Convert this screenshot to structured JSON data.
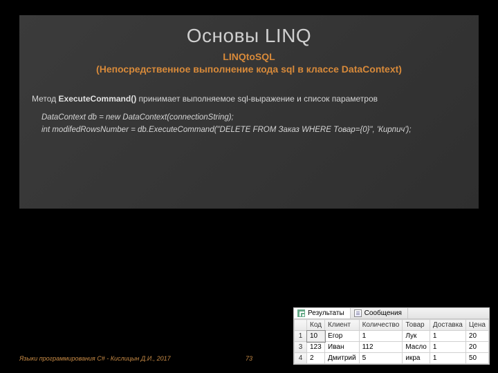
{
  "slide": {
    "title": "Основы LINQ",
    "subtitle": "LINQtoSQL",
    "subtitle2": "(Непосредственное выполнение кода sql в классе DataContext)",
    "body_pre": "Метод ",
    "body_strong": "ExecuteCommand()",
    "body_post": " принимает выполняемое sql-выражение и список параметров",
    "code": "DataContext db = new DataContext(connectionString);\nint modifedRowsNumber = db.ExecuteCommand(\"DELETE FROM Заказ WHERE Товар={0}\", 'Кирпич');",
    "footer": "Языки программирования C# - Кислицын Д.И., 2017",
    "page": "73"
  },
  "results_panel": {
    "tabs": [
      {
        "label": "Результаты",
        "icon": "grid-icon",
        "active": true
      },
      {
        "label": "Сообщения",
        "icon": "message-icon",
        "active": false
      }
    ],
    "columns": [
      "Код",
      "Клиент",
      "Количество",
      "Товар",
      "Доставка",
      "Цена"
    ],
    "rows": [
      {
        "n": "1",
        "cells": [
          "10",
          "Егор",
          "1",
          "Лук",
          "1",
          "20"
        ],
        "selected_col": 0
      },
      {
        "n": "3",
        "cells": [
          "123",
          "Иван",
          "112",
          "Масло",
          "1",
          "20"
        ]
      },
      {
        "n": "4",
        "cells": [
          "2",
          "Дмитрий",
          "5",
          "икра",
          "1",
          "50"
        ]
      }
    ]
  }
}
